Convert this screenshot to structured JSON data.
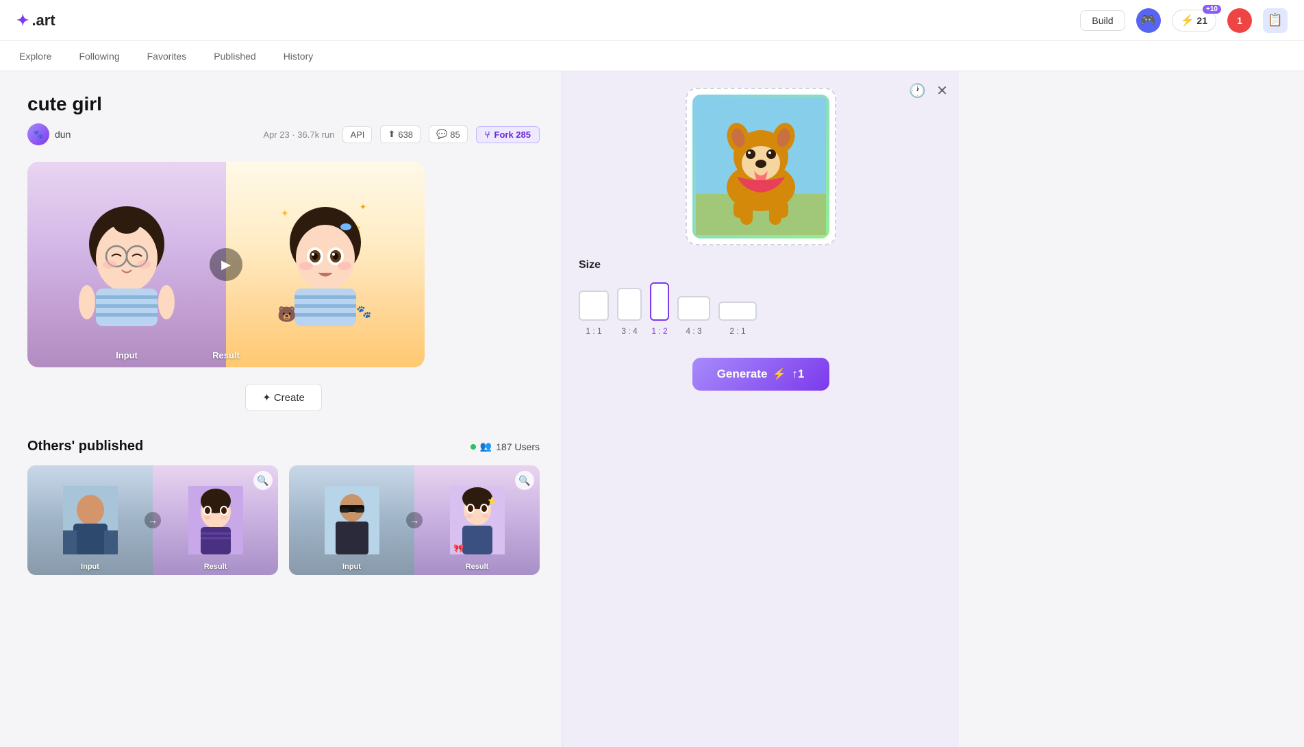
{
  "header": {
    "logo_icon": "✦",
    "logo_text": ".art",
    "build_label": "Build",
    "lightning_count": "21",
    "lightning_badge": "+10",
    "notif_count": "1"
  },
  "nav": {
    "items": [
      {
        "label": "Explore",
        "active": false
      },
      {
        "label": "Following",
        "active": false
      },
      {
        "label": "Favorites",
        "active": false
      },
      {
        "label": "Published",
        "active": false
      },
      {
        "label": "History",
        "active": false
      }
    ]
  },
  "page": {
    "title": "cute girl",
    "author": "dun",
    "date": "Apr 23",
    "run_count": "36.7k run",
    "api_label": "API",
    "fork_count": "638",
    "comment_count": "85",
    "fork_label": "Fork 285",
    "preview": {
      "input_label": "Input",
      "result_label": "Result"
    },
    "create_label": "✦ Create"
  },
  "others": {
    "title": "Others' published",
    "users_count": "187 Users",
    "items": [
      {
        "input_label": "Input",
        "result_label": "Result"
      },
      {
        "input_label": "Input",
        "result_label": "Result"
      }
    ]
  },
  "right_panel": {
    "size_title": "Size",
    "sizes": [
      {
        "label": "1 : 1",
        "active": false
      },
      {
        "label": "3 : 4",
        "active": false
      },
      {
        "label": "1 : 2",
        "active": true
      },
      {
        "label": "4 : 3",
        "active": false
      },
      {
        "label": "2 : 1",
        "active": false
      }
    ],
    "generate_label": "Generate",
    "generate_cost": "↑1"
  }
}
